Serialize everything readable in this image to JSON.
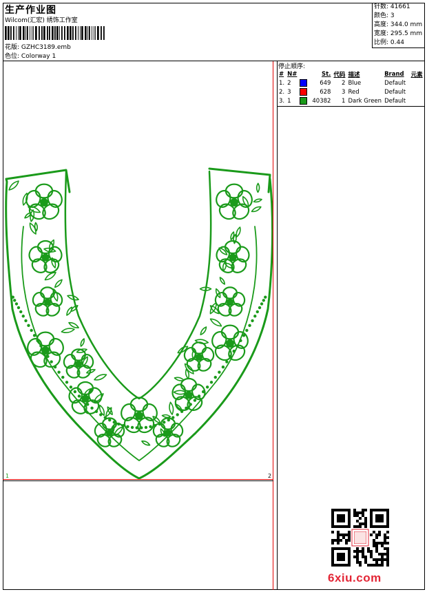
{
  "header": {
    "title": "生产作业图",
    "subtitle": "Wilcom(汇宏) 绣饰工作室",
    "pattern_label": "花版:",
    "pattern_value": "GZHC3189.emb",
    "colorway_label": "色位:",
    "colorway_value": "Colorway 1"
  },
  "stats": {
    "stitches_label": "针数:",
    "stitches_value": "41661",
    "colors_label": "颜色:",
    "colors_value": "3",
    "height_label": "高度:",
    "height_value": "344.0 mm",
    "width_label": "宽度:",
    "width_value": "295.5 mm",
    "scale_label": "比例:",
    "scale_value": "0.44"
  },
  "stop_sequence": {
    "title": "停止顺序:",
    "columns": [
      "#",
      "N#",
      "St.",
      "代码",
      "描述",
      "Brand",
      "元素"
    ],
    "rows": [
      {
        "seq": "1.",
        "n": "2",
        "color": "#0000ff",
        "st": "649",
        "code": "2",
        "desc": "Blue",
        "brand": "Default"
      },
      {
        "seq": "2.",
        "n": "3",
        "color": "#ff0000",
        "st": "628",
        "code": "3",
        "desc": "Red",
        "brand": "Default"
      },
      {
        "seq": "3.",
        "n": "1",
        "color": "#1a9a1a",
        "st": "40382",
        "code": "1",
        "desc": "Dark Green",
        "brand": "Default"
      }
    ]
  },
  "canvas": {
    "marker_left": "1",
    "marker_right": "2",
    "design_color": "#1a9a1a"
  },
  "watermark": "6xiu.com"
}
